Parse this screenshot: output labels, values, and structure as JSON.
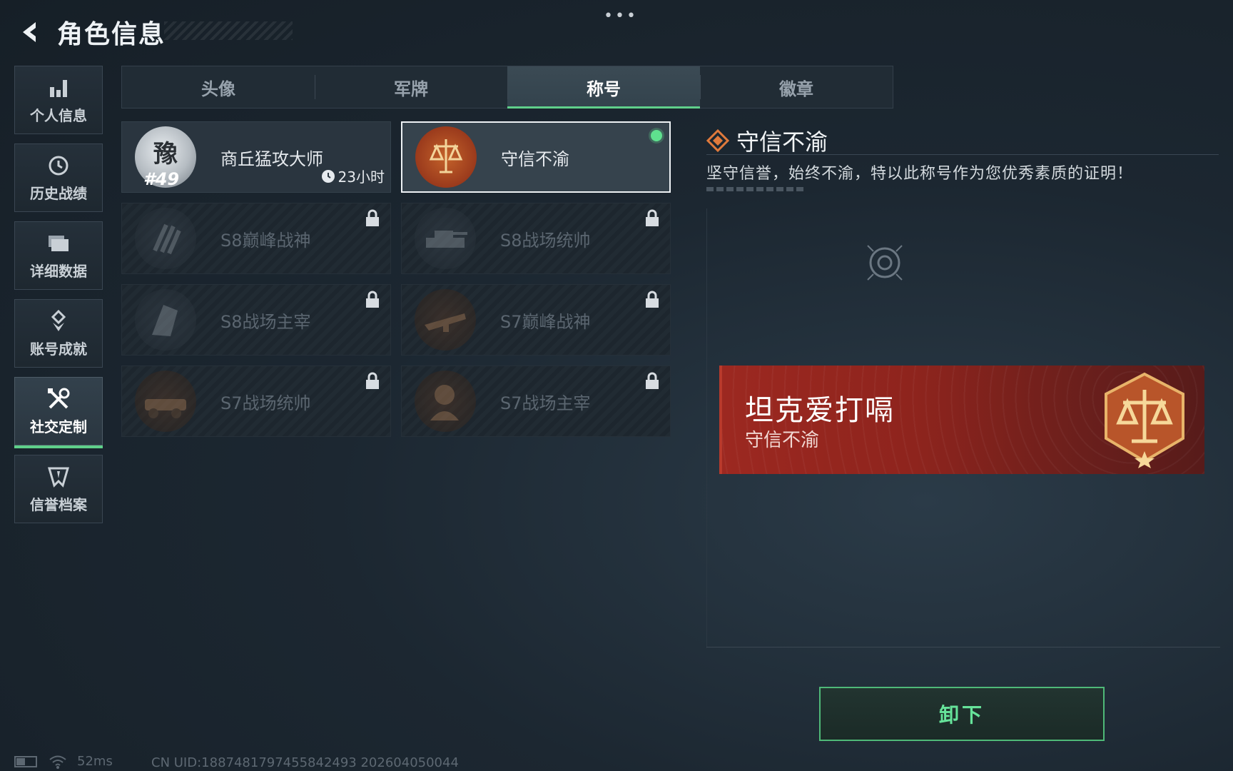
{
  "header": {
    "title": "角色信息"
  },
  "sidebar": {
    "items": [
      {
        "label": "个人信息",
        "icon": "bar-chart-icon"
      },
      {
        "label": "历史战绩",
        "icon": "clock-history-icon"
      },
      {
        "label": "详细数据",
        "icon": "folder-icon"
      },
      {
        "label": "账号成就",
        "icon": "medal-icon"
      },
      {
        "label": "社交定制",
        "icon": "wrench-screwdriver-icon",
        "active": true
      },
      {
        "label": "信誉档案",
        "icon": "shield-icon"
      }
    ]
  },
  "tabs": [
    {
      "label": "头像"
    },
    {
      "label": "军牌"
    },
    {
      "label": "称号",
      "active": true
    },
    {
      "label": "徽章"
    }
  ],
  "titles": [
    {
      "name": "商丘猛攻大师",
      "rank": "#49",
      "timer": "23小时",
      "state": "owned"
    },
    {
      "name": "守信不渝",
      "state": "equipped"
    },
    {
      "name": "S8巅峰战神",
      "state": "locked"
    },
    {
      "name": "S8战场统帅",
      "state": "locked"
    },
    {
      "name": "S8战场主宰",
      "state": "locked"
    },
    {
      "name": "S7巅峰战神",
      "state": "locked"
    },
    {
      "name": "S7战场统帅",
      "state": "locked"
    },
    {
      "name": "S7战场主宰",
      "state": "locked"
    }
  ],
  "detail": {
    "title": "守信不渝",
    "description": "坚守信誉，始终不渝，特以此称号作为您优秀素质的证明！",
    "preview": {
      "player_name": "坦克爱打嗝",
      "title": "守信不渝"
    },
    "action_label": "卸下"
  },
  "status": {
    "ping": "52ms",
    "uid": "CN UID:1887481797455842493 202604050044"
  },
  "colors": {
    "accent": "#5fd08a",
    "banner_red": "#9c2820",
    "emblem_orange": "#c4622a"
  }
}
